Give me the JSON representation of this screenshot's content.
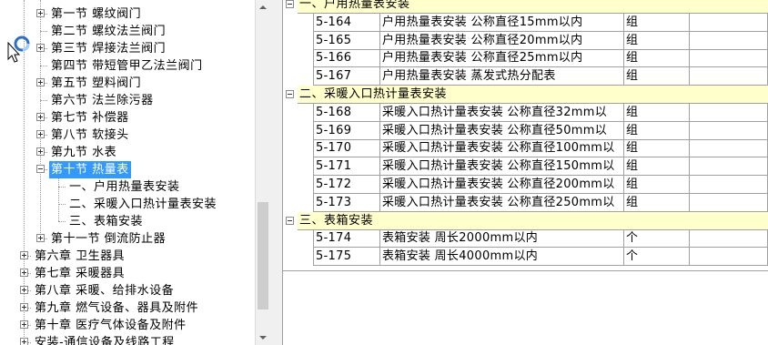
{
  "tree": {
    "items": [
      {
        "label": "第一节  螺纹阀门",
        "toggle": "plus"
      },
      {
        "label": "第二节  螺纹法兰阀门",
        "toggle": "none"
      },
      {
        "label": "第三节  焊接法兰阀门",
        "toggle": "plus"
      },
      {
        "label": "第四节  带短管甲乙法兰阀门",
        "toggle": "none"
      },
      {
        "label": "第五节  塑料阀门",
        "toggle": "plus"
      },
      {
        "label": "第六节  法兰除污器",
        "toggle": "none"
      },
      {
        "label": "第七节  补偿器",
        "toggle": "plus"
      },
      {
        "label": "第八节  软接头",
        "toggle": "plus"
      },
      {
        "label": "第九节  水表",
        "toggle": "plus"
      },
      {
        "label": "第十节  热量表",
        "toggle": "minus",
        "selected": true
      },
      {
        "label": "一、户用热量表安装",
        "toggle": "none"
      },
      {
        "label": "二、采暖入口热计量表安装",
        "toggle": "none"
      },
      {
        "label": "三、表箱安装",
        "toggle": "none"
      },
      {
        "label": "第十一节  倒流防止器",
        "toggle": "plus"
      },
      {
        "label": "第六章  卫生器具",
        "toggle": "plus"
      },
      {
        "label": "第七章  采暖器具",
        "toggle": "plus"
      },
      {
        "label": "第八章  采暖、给排水设备",
        "toggle": "plus"
      },
      {
        "label": "第九章  燃气设备、器具及附件",
        "toggle": "plus"
      },
      {
        "label": "第十章  医疗气体设备及附件",
        "toggle": "plus"
      },
      {
        "label": "安装-通信设备及线路工程",
        "toggle": "plus"
      }
    ]
  },
  "grid": {
    "groups": [
      {
        "title": "一、户用热量表安装",
        "rows": [
          {
            "code": "5-164",
            "name": "户用热量表安装 公称直径15mm以内",
            "unit": "组"
          },
          {
            "code": "5-165",
            "name": "户用热量表安装 公称直径20mm以内",
            "unit": "组"
          },
          {
            "code": "5-166",
            "name": "户用热量表安装 公称直径25mm以内",
            "unit": "组"
          },
          {
            "code": "5-167",
            "name": "户用热量表安装 蒸发式热分配表",
            "unit": "组"
          }
        ]
      },
      {
        "title": "二、采暖入口热计量表安装",
        "rows": [
          {
            "code": "5-168",
            "name": "采暖入口热计量表安装 公称直径32mm以",
            "unit": "组"
          },
          {
            "code": "5-169",
            "name": "采暖入口热计量表安装 公称直径50mm以",
            "unit": "组"
          },
          {
            "code": "5-170",
            "name": "采暖入口热计量表安装 公称直径100mm以",
            "unit": "组"
          },
          {
            "code": "5-171",
            "name": "采暖入口热计量表安装 公称直径150mm以",
            "unit": "组"
          },
          {
            "code": "5-172",
            "name": "采暖入口热计量表安装 公称直径200mm以",
            "unit": "组"
          },
          {
            "code": "5-173",
            "name": "采暖入口热计量表安装 公称直径250mm以",
            "unit": "组"
          }
        ]
      },
      {
        "title": "三、表箱安装",
        "rows": [
          {
            "code": "5-174",
            "name": "表箱安装 周长2000mm以内",
            "unit": "个"
          },
          {
            "code": "5-175",
            "name": "表箱安装 周长4000mm以内",
            "unit": "个"
          }
        ]
      }
    ]
  },
  "colors": {
    "selection": "#3399ff",
    "group_header_bg": "#ffffcc",
    "grid_line": "#a0a0a0"
  },
  "icons": {
    "cursor": "busy-arrow-cursor-icon"
  }
}
